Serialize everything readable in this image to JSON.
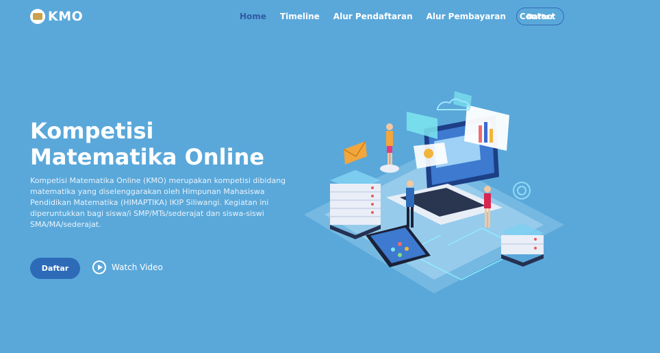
{
  "brand": {
    "name": "KMO"
  },
  "nav": {
    "links": [
      {
        "label": "Home",
        "active": true
      },
      {
        "label": "Timeline"
      },
      {
        "label": "Alur Pendaftaran"
      },
      {
        "label": "Alur Pembayaran"
      },
      {
        "label": "Contact"
      }
    ],
    "cta_label": "Daftar"
  },
  "hero": {
    "title": "Kompetisi Matematika Online",
    "description": "Kompetisi Matematika Online (KMO) merupakan kompetisi dibidang matematika yang diselenggarakan oleh Himpunan Mahasiswa Pendidikan Matematika (HIMAPTIKA) IKIP Siliwangi. Kegiatan ini diperuntukkan bagi siswa/i SMP/MTs/sederajat dan siswa-siswi SMA/MA/sederajat.",
    "primary_button": "Daftar",
    "video_label": "Watch Video"
  },
  "colors": {
    "background": "#5aa8da",
    "accent": "#2d6bb8",
    "active_nav": "#2f5aa3"
  },
  "icons": {
    "logo": "kmo-logo-icon",
    "play": "play-circle-icon"
  }
}
